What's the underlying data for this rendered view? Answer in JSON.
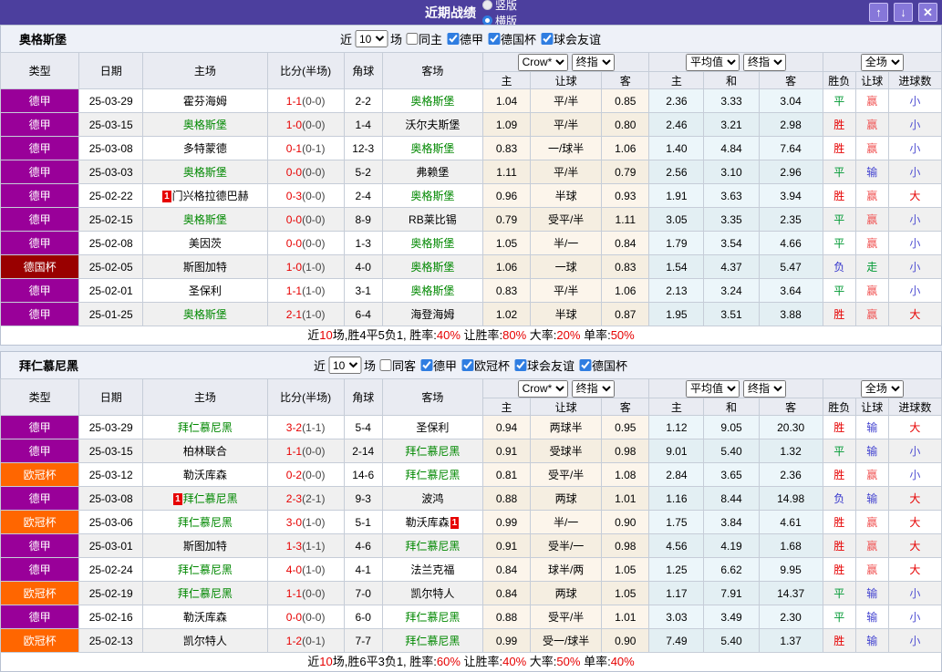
{
  "titlebar": {
    "title": "近期战绩",
    "view_options": [
      {
        "label": "竖版",
        "selected": false
      },
      {
        "label": "横版",
        "selected": true
      }
    ],
    "window_buttons": [
      {
        "name": "move-up-button",
        "icon": "up-arrow-icon",
        "glyph": "↑"
      },
      {
        "name": "move-down-button",
        "icon": "down-arrow-icon",
        "glyph": "↓"
      },
      {
        "name": "close-button",
        "icon": "close-icon",
        "glyph": "✕"
      }
    ]
  },
  "columns": {
    "left": [
      "类型",
      "日期",
      "主场",
      "比分(半场)",
      "角球",
      "客场"
    ],
    "group1": {
      "selects": [
        "Crow*",
        "终指"
      ],
      "cols": [
        "主",
        "让球",
        "客"
      ]
    },
    "group2": {
      "selects": [
        "平均值",
        "终指"
      ],
      "cols": [
        "主",
        "和",
        "客"
      ]
    },
    "group3": {
      "selects": [
        "全场"
      ],
      "cols": [
        "胜负",
        "让球",
        "进球数"
      ]
    }
  },
  "league_colors": {
    "德甲": "#990099",
    "德国杯": "#990000",
    "欧冠杯": "#ff6600"
  },
  "result_colors": {
    "胜": "#e60000",
    "平": "#009933",
    "负": "#3434cc",
    "赢": "#f05555",
    "走": "#009933",
    "输": "#3f3fcf",
    "大": "#e60000",
    "小": "#5050d2"
  },
  "sections": [
    {
      "team": "奥格斯堡",
      "filters": {
        "near_label": "近",
        "count": "10",
        "games_label": "场",
        "checkboxes": [
          {
            "label": "同主",
            "checked": false
          },
          {
            "label": "德甲",
            "checked": true
          },
          {
            "label": "德国杯",
            "checked": true
          },
          {
            "label": "球会友谊",
            "checked": true
          }
        ]
      },
      "rows": [
        {
          "league": "德甲",
          "date": "25-03-29",
          "home": {
            "name": "霍芬海姆",
            "self": false
          },
          "score": {
            "ft": "1-1",
            "ht": "(0-0)"
          },
          "corner": "2-2",
          "away": {
            "name": "奥格斯堡",
            "self": true
          },
          "crow": [
            "1.04",
            "平/半",
            "0.85"
          ],
          "avg": [
            "2.36",
            "3.33",
            "3.04"
          ],
          "results": [
            "平",
            "赢",
            "小"
          ]
        },
        {
          "league": "德甲",
          "date": "25-03-15",
          "home": {
            "name": "奥格斯堡",
            "self": true
          },
          "score": {
            "ft": "1-0",
            "ht": "(0-0)"
          },
          "corner": "1-4",
          "away": {
            "name": "沃尔夫斯堡",
            "self": false
          },
          "crow": [
            "1.09",
            "平/半",
            "0.80"
          ],
          "avg": [
            "2.46",
            "3.21",
            "2.98"
          ],
          "results": [
            "胜",
            "赢",
            "小"
          ]
        },
        {
          "league": "德甲",
          "date": "25-03-08",
          "home": {
            "name": "多特蒙德",
            "self": false
          },
          "score": {
            "ft": "0-1",
            "ht": "(0-1)"
          },
          "corner": "12-3",
          "away": {
            "name": "奥格斯堡",
            "self": true
          },
          "crow": [
            "0.83",
            "一/球半",
            "1.06"
          ],
          "avg": [
            "1.40",
            "4.84",
            "7.64"
          ],
          "results": [
            "胜",
            "赢",
            "小"
          ]
        },
        {
          "league": "德甲",
          "date": "25-03-03",
          "home": {
            "name": "奥格斯堡",
            "self": true
          },
          "score": {
            "ft": "0-0",
            "ht": "(0-0)"
          },
          "corner": "5-2",
          "away": {
            "name": "弗赖堡",
            "self": false
          },
          "crow": [
            "1.11",
            "平/半",
            "0.79"
          ],
          "avg": [
            "2.56",
            "3.10",
            "2.96"
          ],
          "results": [
            "平",
            "输",
            "小"
          ]
        },
        {
          "league": "德甲",
          "date": "25-02-22",
          "home": {
            "name": "门兴格拉德巴赫",
            "self": false,
            "card": "1",
            "card_pos": "pre"
          },
          "score": {
            "ft": "0-3",
            "ht": "(0-0)"
          },
          "corner": "2-4",
          "away": {
            "name": "奥格斯堡",
            "self": true
          },
          "crow": [
            "0.96",
            "半球",
            "0.93"
          ],
          "avg": [
            "1.91",
            "3.63",
            "3.94"
          ],
          "results": [
            "胜",
            "赢",
            "大"
          ]
        },
        {
          "league": "德甲",
          "date": "25-02-15",
          "home": {
            "name": "奥格斯堡",
            "self": true
          },
          "score": {
            "ft": "0-0",
            "ht": "(0-0)"
          },
          "corner": "8-9",
          "away": {
            "name": "RB莱比锡",
            "self": false
          },
          "crow": [
            "0.79",
            "受平/半",
            "1.11"
          ],
          "avg": [
            "3.05",
            "3.35",
            "2.35"
          ],
          "results": [
            "平",
            "赢",
            "小"
          ]
        },
        {
          "league": "德甲",
          "date": "25-02-08",
          "home": {
            "name": "美因茨",
            "self": false
          },
          "score": {
            "ft": "0-0",
            "ht": "(0-0)"
          },
          "corner": "1-3",
          "away": {
            "name": "奥格斯堡",
            "self": true
          },
          "crow": [
            "1.05",
            "半/一",
            "0.84"
          ],
          "avg": [
            "1.79",
            "3.54",
            "4.66"
          ],
          "results": [
            "平",
            "赢",
            "小"
          ]
        },
        {
          "league": "德国杯",
          "date": "25-02-05",
          "home": {
            "name": "斯图加特",
            "self": false
          },
          "score": {
            "ft": "1-0",
            "ht": "(1-0)"
          },
          "corner": "4-0",
          "away": {
            "name": "奥格斯堡",
            "self": true
          },
          "crow": [
            "1.06",
            "一球",
            "0.83"
          ],
          "avg": [
            "1.54",
            "4.37",
            "5.47"
          ],
          "results": [
            "负",
            "走",
            "小"
          ]
        },
        {
          "league": "德甲",
          "date": "25-02-01",
          "home": {
            "name": "圣保利",
            "self": false
          },
          "score": {
            "ft": "1-1",
            "ht": "(1-0)"
          },
          "corner": "3-1",
          "away": {
            "name": "奥格斯堡",
            "self": true
          },
          "crow": [
            "0.83",
            "平/半",
            "1.06"
          ],
          "avg": [
            "2.13",
            "3.24",
            "3.64"
          ],
          "results": [
            "平",
            "赢",
            "小"
          ]
        },
        {
          "league": "德甲",
          "date": "25-01-25",
          "home": {
            "name": "奥格斯堡",
            "self": true
          },
          "score": {
            "ft": "2-1",
            "ht": "(1-0)"
          },
          "corner": "6-4",
          "away": {
            "name": "海登海姆",
            "self": false
          },
          "crow": [
            "1.02",
            "半球",
            "0.87"
          ],
          "avg": [
            "1.95",
            "3.51",
            "3.88"
          ],
          "results": [
            "胜",
            "赢",
            "大"
          ]
        }
      ],
      "summary": [
        {
          "text": "近",
          "hl": false
        },
        {
          "text": "10",
          "hl": true
        },
        {
          "text": "场,胜4平5负1, 胜率:",
          "hl": false
        },
        {
          "text": "40%",
          "hl": true
        },
        {
          "text": " 让胜率:",
          "hl": false
        },
        {
          "text": "80%",
          "hl": true
        },
        {
          "text": " 大率:",
          "hl": false
        },
        {
          "text": "20%",
          "hl": true
        },
        {
          "text": " 单率:",
          "hl": false
        },
        {
          "text": "50%",
          "hl": true
        }
      ]
    },
    {
      "team": "拜仁慕尼黑",
      "filters": {
        "near_label": "近",
        "count": "10",
        "games_label": "场",
        "checkboxes": [
          {
            "label": "同客",
            "checked": false
          },
          {
            "label": "德甲",
            "checked": true
          },
          {
            "label": "欧冠杯",
            "checked": true
          },
          {
            "label": "球会友谊",
            "checked": true
          },
          {
            "label": "德国杯",
            "checked": true
          }
        ]
      },
      "rows": [
        {
          "league": "德甲",
          "date": "25-03-29",
          "home": {
            "name": "拜仁慕尼黑",
            "self": true
          },
          "score": {
            "ft": "3-2",
            "ht": "(1-1)"
          },
          "corner": "5-4",
          "away": {
            "name": "圣保利",
            "self": false
          },
          "crow": [
            "0.94",
            "两球半",
            "0.95"
          ],
          "avg": [
            "1.12",
            "9.05",
            "20.30"
          ],
          "results": [
            "胜",
            "输",
            "大"
          ]
        },
        {
          "league": "德甲",
          "date": "25-03-15",
          "home": {
            "name": "柏林联合",
            "self": false
          },
          "score": {
            "ft": "1-1",
            "ht": "(0-0)"
          },
          "corner": "2-14",
          "away": {
            "name": "拜仁慕尼黑",
            "self": true
          },
          "crow": [
            "0.91",
            "受球半",
            "0.98"
          ],
          "avg": [
            "9.01",
            "5.40",
            "1.32"
          ],
          "results": [
            "平",
            "输",
            "小"
          ]
        },
        {
          "league": "欧冠杯",
          "date": "25-03-12",
          "home": {
            "name": "勒沃库森",
            "self": false
          },
          "score": {
            "ft": "0-2",
            "ht": "(0-0)"
          },
          "corner": "14-6",
          "away": {
            "name": "拜仁慕尼黑",
            "self": true
          },
          "crow": [
            "0.81",
            "受平/半",
            "1.08"
          ],
          "avg": [
            "2.84",
            "3.65",
            "2.36"
          ],
          "results": [
            "胜",
            "赢",
            "小"
          ]
        },
        {
          "league": "德甲",
          "date": "25-03-08",
          "home": {
            "name": "拜仁慕尼黑",
            "self": true,
            "card": "1",
            "card_pos": "pre"
          },
          "score": {
            "ft": "2-3",
            "ht": "(2-1)"
          },
          "corner": "9-3",
          "away": {
            "name": "波鸿",
            "self": false
          },
          "crow": [
            "0.88",
            "两球",
            "1.01"
          ],
          "avg": [
            "1.16",
            "8.44",
            "14.98"
          ],
          "results": [
            "负",
            "输",
            "大"
          ]
        },
        {
          "league": "欧冠杯",
          "date": "25-03-06",
          "home": {
            "name": "拜仁慕尼黑",
            "self": true
          },
          "score": {
            "ft": "3-0",
            "ht": "(1-0)"
          },
          "corner": "5-1",
          "away": {
            "name": "勒沃库森",
            "self": false,
            "card": "1",
            "card_pos": "post"
          },
          "crow": [
            "0.99",
            "半/一",
            "0.90"
          ],
          "avg": [
            "1.75",
            "3.84",
            "4.61"
          ],
          "results": [
            "胜",
            "赢",
            "大"
          ]
        },
        {
          "league": "德甲",
          "date": "25-03-01",
          "home": {
            "name": "斯图加特",
            "self": false
          },
          "score": {
            "ft": "1-3",
            "ht": "(1-1)"
          },
          "corner": "4-6",
          "away": {
            "name": "拜仁慕尼黑",
            "self": true
          },
          "crow": [
            "0.91",
            "受半/一",
            "0.98"
          ],
          "avg": [
            "4.56",
            "4.19",
            "1.68"
          ],
          "results": [
            "胜",
            "赢",
            "大"
          ]
        },
        {
          "league": "德甲",
          "date": "25-02-24",
          "home": {
            "name": "拜仁慕尼黑",
            "self": true
          },
          "score": {
            "ft": "4-0",
            "ht": "(1-0)"
          },
          "corner": "4-1",
          "away": {
            "name": "法兰克福",
            "self": false
          },
          "crow": [
            "0.84",
            "球半/两",
            "1.05"
          ],
          "avg": [
            "1.25",
            "6.62",
            "9.95"
          ],
          "results": [
            "胜",
            "赢",
            "大"
          ]
        },
        {
          "league": "欧冠杯",
          "date": "25-02-19",
          "home": {
            "name": "拜仁慕尼黑",
            "self": true
          },
          "score": {
            "ft": "1-1",
            "ht": "(0-0)"
          },
          "corner": "7-0",
          "away": {
            "name": "凯尔特人",
            "self": false
          },
          "crow": [
            "0.84",
            "两球",
            "1.05"
          ],
          "avg": [
            "1.17",
            "7.91",
            "14.37"
          ],
          "results": [
            "平",
            "输",
            "小"
          ]
        },
        {
          "league": "德甲",
          "date": "25-02-16",
          "home": {
            "name": "勒沃库森",
            "self": false
          },
          "score": {
            "ft": "0-0",
            "ht": "(0-0)"
          },
          "corner": "6-0",
          "away": {
            "name": "拜仁慕尼黑",
            "self": true
          },
          "crow": [
            "0.88",
            "受平/半",
            "1.01"
          ],
          "avg": [
            "3.03",
            "3.49",
            "2.30"
          ],
          "results": [
            "平",
            "输",
            "小"
          ]
        },
        {
          "league": "欧冠杯",
          "date": "25-02-13",
          "home": {
            "name": "凯尔特人",
            "self": false
          },
          "score": {
            "ft": "1-2",
            "ht": "(0-1)"
          },
          "corner": "7-7",
          "away": {
            "name": "拜仁慕尼黑",
            "self": true
          },
          "crow": [
            "0.99",
            "受一/球半",
            "0.90"
          ],
          "avg": [
            "7.49",
            "5.40",
            "1.37"
          ],
          "results": [
            "胜",
            "输",
            "小"
          ]
        }
      ],
      "summary": [
        {
          "text": "近",
          "hl": false
        },
        {
          "text": "10",
          "hl": true
        },
        {
          "text": "场,胜6平3负1, 胜率:",
          "hl": false
        },
        {
          "text": "60%",
          "hl": true
        },
        {
          "text": " 让胜率:",
          "hl": false
        },
        {
          "text": "40%",
          "hl": true
        },
        {
          "text": " 大率:",
          "hl": false
        },
        {
          "text": "50%",
          "hl": true
        },
        {
          "text": " 单率:",
          "hl": false
        },
        {
          "text": "40%",
          "hl": true
        }
      ]
    }
  ]
}
